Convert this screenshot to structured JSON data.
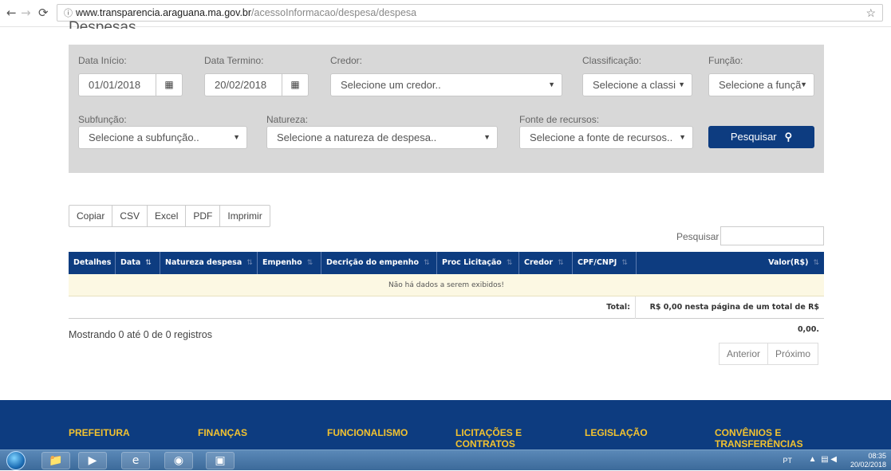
{
  "browser": {
    "url_host": "www.transparencia.araguana.ma.gov.br",
    "url_path": "/acessoInformacao/despesa/despesa",
    "info_icon": "info-icon",
    "star_icon": "star-icon"
  },
  "page": {
    "title": "Despesas"
  },
  "filters": {
    "data_inicio_label": "Data Início:",
    "data_inicio_value": "01/01/2018",
    "data_termino_label": "Data Termino:",
    "data_termino_value": "20/02/2018",
    "credor_label": "Credor:",
    "credor_placeholder": "Selecione um credor..",
    "classificacao_label": "Classificação:",
    "classificacao_placeholder": "Selecione a classi",
    "funcao_label": "Função:",
    "funcao_placeholder": "Selecione a funçã",
    "subfuncao_label": "Subfunção:",
    "subfuncao_placeholder": "Selecione a subfunção..",
    "natureza_label": "Natureza:",
    "natureza_placeholder": "Selecione a natureza de despesa..",
    "fonte_label": "Fonte de recursos:",
    "fonte_placeholder": "Selecione a fonte de recursos..",
    "search_button": "Pesquisar"
  },
  "exports": [
    "Copiar",
    "CSV",
    "Excel",
    "PDF",
    "Imprimir"
  ],
  "table_search_label": "Pesquisar",
  "table": {
    "columns": [
      "Detalhes",
      "Data",
      "Natureza despesa",
      "Empenho",
      "Decrição do empenho",
      "Proc Licitação",
      "Credor",
      "CPF/CNPJ",
      "Valor(R$)"
    ],
    "empty_message": "Não há dados a serem exibidos!",
    "total_label": "Total:",
    "total_value": "R$ 0,00 nesta página de um total de R$ 0,00."
  },
  "info_text": "Mostrando 0 até 0 de 0 registros",
  "pager": {
    "prev": "Anterior",
    "next": "Próximo"
  },
  "footer": {
    "columns": [
      {
        "line1": "PREFEITURA",
        "line2": ""
      },
      {
        "line1": "FINANÇAS",
        "line2": ""
      },
      {
        "line1": "FUNCIONALISMO",
        "line2": ""
      },
      {
        "line1": "LICITAÇÕES E",
        "line2": "CONTRATOS"
      },
      {
        "line1": "LEGISLAÇÃO",
        "line2": ""
      },
      {
        "line1": "CONVÊNIOS E",
        "line2": "TRANSFERÊNCIAS"
      }
    ]
  },
  "taskbar": {
    "language": "PT",
    "time": "08:35",
    "date": "20/02/2018"
  },
  "colors": {
    "brand_blue": "#0d3c80",
    "footer_accent": "#f2c230",
    "empty_row": "#fcf8e3"
  }
}
